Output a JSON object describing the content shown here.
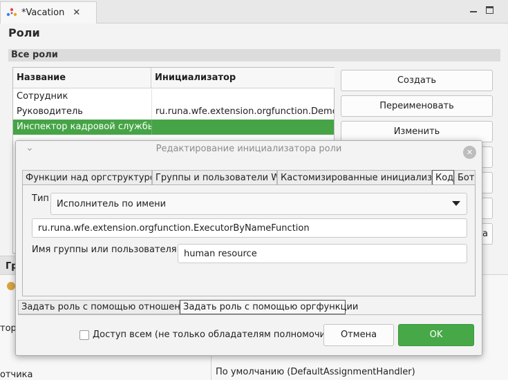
{
  "editor": {
    "tab_title": "*Vacation",
    "close_glyph": "✕"
  },
  "page": {
    "title": "Роли",
    "section_title": "Все роли"
  },
  "roles_table": {
    "columns": [
      "Название",
      "Инициализатор"
    ],
    "rows": [
      {
        "name": "Сотрудник",
        "initializer": ""
      },
      {
        "name": "Руководитель",
        "initializer": "ru.runa.wfe.extension.orgfunction.DemoChiefFunction"
      },
      {
        "name": "Инспектор кадровой службы",
        "initializer": ""
      }
    ],
    "selected_index": 2
  },
  "side_buttons": {
    "create": "Создать",
    "rename": "Переименовать",
    "edit": "Изменить",
    "partial_letter": "а"
  },
  "background": {
    "left_fragment": "Гр",
    "frag_tor": "тор",
    "frag_otchika": "отчика",
    "default_handler": "По умолчанию (DefaultAssignmentHandler)"
  },
  "dialog": {
    "title": "Редактирование инициализатора роли",
    "chevron": "⌄",
    "close_glyph": "✕",
    "upper_tabs": [
      "Функции над оргструктурой",
      "Группы и пользователи WF",
      "Кастомизированные инициализ...",
      "Код",
      "Бот"
    ],
    "upper_active_index": 3,
    "type_label": "Тип",
    "type_value": "Исполнитель по имени",
    "function_value": "ru.runa.wfe.extension.orgfunction.ExecutorByNameFunction",
    "group_label": "Имя группы или пользователя *:",
    "group_value": "human resource",
    "lower_tabs": [
      "Задать роль с помощью отношения",
      "Задать роль с помощью оргфункции"
    ],
    "lower_active_index": 1,
    "access_all_label": "Доступ всем (не только обладателям полномочий)",
    "access_all_checked": false,
    "cancel_label": "Отмена",
    "ok_label": "OK"
  },
  "colors": {
    "accent_green": "#46a446",
    "window_bg": "#f3f3f3"
  }
}
